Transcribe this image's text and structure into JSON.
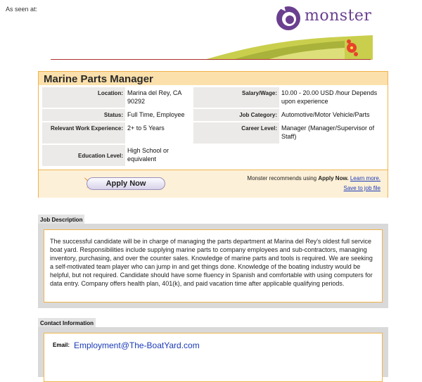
{
  "header": {
    "as_seen": "As seen at:",
    "brand": "monster"
  },
  "job": {
    "title": "Marine Parts Manager",
    "rows": [
      {
        "l1": "Location:",
        "v1": "Marina del Rey, CA 90292",
        "l2": "Salary/Wage:",
        "v2": "10.00 - 20.00 USD /hour Depends upon experience"
      },
      {
        "l1": "Status:",
        "v1": "Full Time, Employee",
        "l2": "Job Category:",
        "v2": "Automotive/Motor Vehicle/Parts"
      },
      {
        "l1": "Relevant Work Experience:",
        "v1": "2+ to 5 Years",
        "l2": "Career Level:",
        "v2": "Manager (Manager/Supervisor of Staff)"
      },
      {
        "l1": "Education Level:",
        "v1": "High School or equivalent",
        "l2": "",
        "v2": ""
      }
    ],
    "apply_label": "Apply Now",
    "recommend_prefix": "Monster recommends using",
    "recommend_bold": "Apply Now.",
    "learn_more": "Learn more.",
    "save_label": "Save to job file"
  },
  "description": {
    "tab": "Job Description",
    "text": "The successful candidate will be in charge of managing the parts department at Marina del Rey's oldest full service boat yard.  Responsibilities include supplying marine parts to company employees and sub-contractors, managing inventory, purchasing, and over the counter sales.  Knowledge of marine parts and tools is required.  We are seeking a self-motivated team player who can jump in and get things done.  Knowledge of the boating industry would be helpful, but not required.  Candidate should have some fluency in Spanish and comfortable with using computers for data entry.  Company offers health plan, 401(k), and paid vacation time after applicable qualifying periods."
  },
  "contact": {
    "tab": "Contact Information",
    "email_label": "Email:",
    "email": "Employment@The-BoatYard.com"
  },
  "colors": {
    "card_border": "#f1b34a",
    "title_bar": "#fbe0ab",
    "link": "#1a3ab8",
    "brand_purple": "#6a3f8f"
  }
}
